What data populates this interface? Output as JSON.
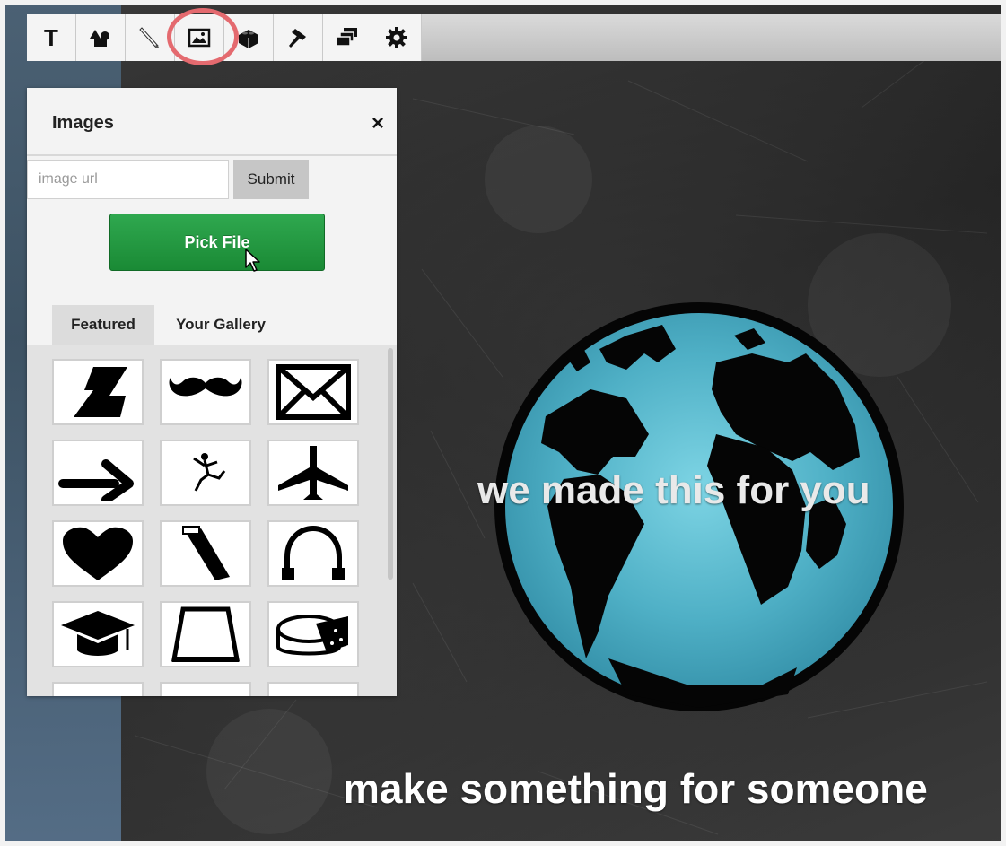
{
  "toolbar": {
    "tools": [
      {
        "name": "text",
        "icon": "text-t-icon",
        "glyph": "T"
      },
      {
        "name": "shapes",
        "icon": "shapes-icon"
      },
      {
        "name": "draw",
        "icon": "pencil-icon"
      },
      {
        "name": "images",
        "icon": "image-icon",
        "highlighted": true
      },
      {
        "name": "blocks",
        "icon": "lego-brick-icon"
      },
      {
        "name": "hammer",
        "icon": "hammer-icon"
      },
      {
        "name": "layers",
        "icon": "layers-icon"
      },
      {
        "name": "settings",
        "icon": "gear-icon"
      }
    ]
  },
  "panel": {
    "title": "Images",
    "close_glyph": "×",
    "url_placeholder": "image url",
    "url_value": "",
    "submit_label": "Submit",
    "pick_file_label": "Pick File",
    "tabs": [
      {
        "label": "Featured",
        "active": true
      },
      {
        "label": "Your Gallery",
        "active": false
      }
    ],
    "thumbnails": [
      "lightning-shape-icon",
      "mustache-icon",
      "envelope-icon",
      "arrow-right-icon",
      "skydiver-icon",
      "airplane-icon",
      "heart-icon",
      "rolled-paper-icon",
      "headphones-icon",
      "graduation-cap-icon",
      "bucket-icon",
      "cheese-icon"
    ]
  },
  "canvas": {
    "caption_primary": "we made this for you",
    "caption_secondary": "make something for someone",
    "globe_icon": "earth-globe-icon"
  },
  "colors": {
    "accent_green": "#1f9a3f",
    "highlight_ring": "#e46a6f",
    "globe_water": "#5cb8cc"
  }
}
